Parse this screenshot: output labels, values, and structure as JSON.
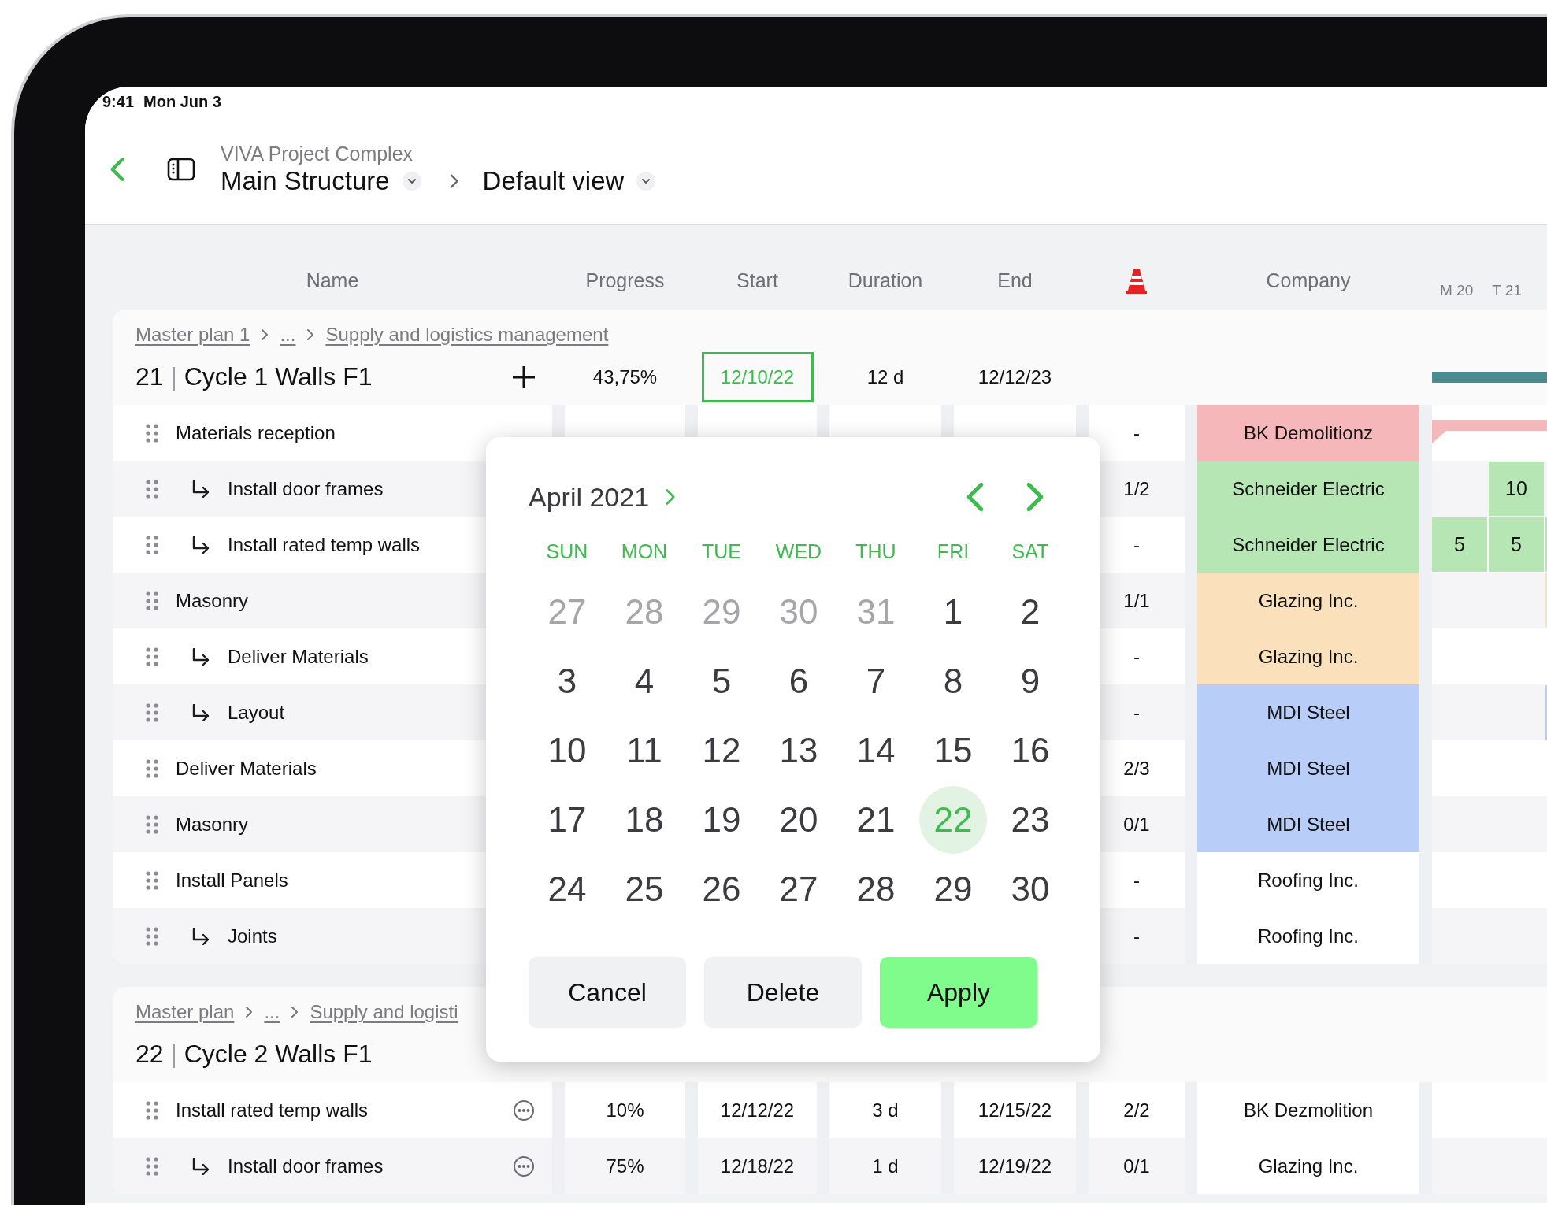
{
  "status_bar": {
    "time": "9:41",
    "date": "Mon Jun 3"
  },
  "header": {
    "project": "VIVA Project Complex",
    "structure": "Main Structure",
    "view": "Default view"
  },
  "columns": [
    {
      "kind": "text",
      "label": "Name"
    },
    {
      "kind": "text",
      "label": "Progress"
    },
    {
      "kind": "text",
      "label": "Start"
    },
    {
      "kind": "text",
      "label": "Duration"
    },
    {
      "kind": "text",
      "label": "End"
    },
    {
      "kind": "constraint"
    },
    {
      "kind": "text",
      "label": "Company"
    }
  ],
  "timeline_days": [
    "M 20",
    "T 21"
  ],
  "groups": [
    {
      "breadcrumb": [
        "Master plan 1",
        "...",
        "Supply and logistics management"
      ],
      "number": "21",
      "separator": "|",
      "name": "Cycle 1 Walls F1",
      "progress": "43,75%",
      "start": {
        "value": "12/10/22",
        "selected": true
      },
      "duration": "12 d",
      "end": "12/12/23",
      "gantt": [
        {
          "kind": "summary"
        }
      ],
      "rows": [
        {
          "name": "Materials reception",
          "constraint": "-",
          "company": "BK Demolitionz",
          "color": "#f6b7ba",
          "gantt": [
            {
              "kind": "bar"
            }
          ],
          "children": [
            {
              "name": "Install door frames",
              "constraint": "1/2",
              "company": "Schneider Electric",
              "color": "#b7e6b5",
              "gantt": [
                {
                  "kind": "empty"
                },
                {
                  "kind": "cell",
                  "label": "10"
                }
              ]
            },
            {
              "name": "Install rated temp walls",
              "constraint": "-",
              "company": "Schneider Electric",
              "color": "#b7e6b5",
              "gantt": [
                {
                  "kind": "cell",
                  "label": "5"
                },
                {
                  "kind": "cell",
                  "label": "5"
                },
                {
                  "kind": "edge"
                }
              ]
            }
          ]
        },
        {
          "name": "Masonry",
          "constraint": "1/1",
          "company": "Glazing Inc.",
          "color": "#fae1bb",
          "gantt": [
            {
              "kind": "empty"
            },
            {
              "kind": "empty"
            },
            {
              "kind": "edge"
            }
          ],
          "children": [
            {
              "name": "Deliver Materials",
              "constraint": "-",
              "company": "Glazing Inc.",
              "color": "#fae1bb"
            },
            {
              "name": "Layout",
              "constraint": "-",
              "company": "MDI Steel",
              "color": "#b8cdf8",
              "gantt": [
                {
                  "kind": "empty"
                },
                {
                  "kind": "empty"
                },
                {
                  "kind": "edge"
                }
              ]
            }
          ]
        },
        {
          "name": "Deliver Materials",
          "constraint": "2/3",
          "company": "MDI Steel",
          "color": "#b8cdf8"
        },
        {
          "name": "Masonry",
          "constraint": "0/1",
          "company": "MDI Steel",
          "color": "#b8cdf8"
        },
        {
          "name": "Install Panels",
          "constraint": "-",
          "company": "Roofing Inc.",
          "color": "#ffffff",
          "children": [
            {
              "name": "Joints",
              "constraint": "-",
              "company": "Roofing Inc.",
              "color": "#ffffff"
            }
          ]
        }
      ]
    },
    {
      "breadcrumb": [
        "Master plan",
        "...",
        "Supply and logisti"
      ],
      "number": "22",
      "separator": "|",
      "name": "Cycle 2 Walls F1",
      "rows": [
        {
          "name": "Install rated temp walls",
          "progress": "10%",
          "start": "12/12/22",
          "duration": "3 d",
          "end": "12/15/22",
          "constraint": "2/2",
          "company": "BK Dezmolition",
          "color": "#ffffff",
          "children": [
            {
              "name": "Install door frames",
              "progress": "75%",
              "start": "12/18/22",
              "duration": "1 d",
              "end": "12/19/22",
              "constraint": "0/1",
              "company": "Glazing Inc.",
              "color": "#ffffff"
            }
          ]
        }
      ]
    }
  ],
  "date_picker": {
    "month": "April 2021",
    "weekdays": [
      "SUN",
      "MON",
      "TUE",
      "WED",
      "THU",
      "FRI",
      "SAT"
    ],
    "days": [
      {
        "label": "27",
        "kind": "outside",
        "selected": false
      },
      {
        "label": "28",
        "kind": "outside",
        "selected": false
      },
      {
        "label": "29",
        "kind": "outside",
        "selected": false
      },
      {
        "label": "30",
        "kind": "outside",
        "selected": false
      },
      {
        "label": "31",
        "kind": "outside",
        "selected": false
      },
      {
        "label": "1",
        "kind": "day",
        "selected": false
      },
      {
        "label": "2",
        "kind": "day",
        "selected": false
      },
      {
        "label": "3",
        "kind": "day",
        "selected": false
      },
      {
        "label": "4",
        "kind": "day",
        "selected": false
      },
      {
        "label": "5",
        "kind": "day",
        "selected": false
      },
      {
        "label": "6",
        "kind": "day",
        "selected": false
      },
      {
        "label": "7",
        "kind": "day",
        "selected": false
      },
      {
        "label": "8",
        "kind": "day",
        "selected": false
      },
      {
        "label": "9",
        "kind": "day",
        "selected": false
      },
      {
        "label": "10",
        "kind": "day",
        "selected": false
      },
      {
        "label": "11",
        "kind": "day",
        "selected": false
      },
      {
        "label": "12",
        "kind": "day",
        "selected": false
      },
      {
        "label": "13",
        "kind": "day",
        "selected": false
      },
      {
        "label": "14",
        "kind": "day",
        "selected": false
      },
      {
        "label": "15",
        "kind": "day",
        "selected": false
      },
      {
        "label": "16",
        "kind": "day",
        "selected": false
      },
      {
        "label": "17",
        "kind": "day",
        "selected": false
      },
      {
        "label": "18",
        "kind": "day",
        "selected": false
      },
      {
        "label": "19",
        "kind": "day",
        "selected": false
      },
      {
        "label": "20",
        "kind": "day",
        "selected": false
      },
      {
        "label": "21",
        "kind": "day",
        "selected": false
      },
      {
        "label": "22",
        "kind": "day",
        "selected": true
      },
      {
        "label": "23",
        "kind": "day",
        "selected": false
      },
      {
        "label": "24",
        "kind": "day",
        "selected": false
      },
      {
        "label": "25",
        "kind": "day",
        "selected": false
      },
      {
        "label": "26",
        "kind": "day",
        "selected": false
      },
      {
        "label": "27",
        "kind": "day",
        "selected": false
      },
      {
        "label": "28",
        "kind": "day",
        "selected": false
      },
      {
        "label": "29",
        "kind": "day",
        "selected": false
      },
      {
        "label": "30",
        "kind": "day",
        "selected": false
      }
    ],
    "buttons": [
      {
        "label": "Cancel",
        "kind": "secondary"
      },
      {
        "label": "Delete",
        "kind": "secondary"
      },
      {
        "label": "Apply",
        "kind": "primary"
      }
    ]
  }
}
